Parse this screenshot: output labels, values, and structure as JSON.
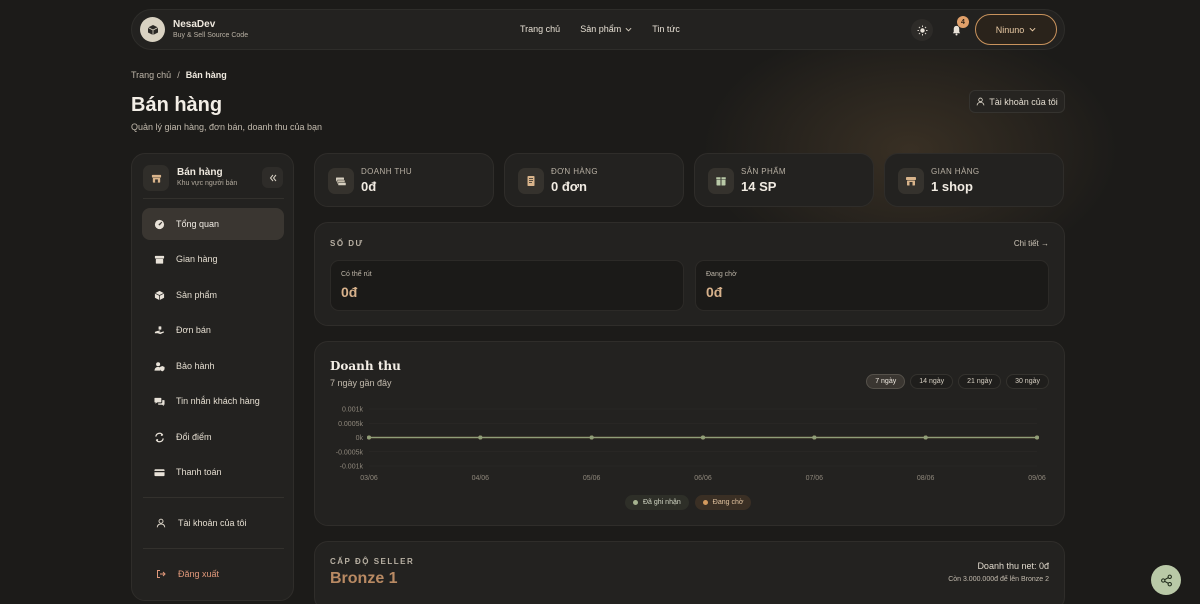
{
  "header": {
    "brand_name": "NesaDev",
    "brand_tagline": "Buy & Sell Source Code",
    "nav": [
      "Trang chủ",
      "Sản phẩm",
      "Tin tức"
    ],
    "notification_count": "4",
    "user_name": "Ninuno"
  },
  "breadcrumb": {
    "home": "Trang chủ",
    "separator": "/",
    "current": "Bán hàng"
  },
  "page": {
    "title": "Bán hàng",
    "subtitle": "Quản lý gian hàng, đơn bán, doanh thu của bạn",
    "account_button": "Tài khoản của tôi"
  },
  "sidebar": {
    "title": "Bán hàng",
    "subtitle": "Khu vực người bán",
    "items": [
      {
        "label": "Tổng quan",
        "icon": "dashboard-icon",
        "active": true
      },
      {
        "label": "Gian hàng",
        "icon": "store-icon"
      },
      {
        "label": "Sản phẩm",
        "icon": "box-icon"
      },
      {
        "label": "Đơn bán",
        "icon": "hand-icon"
      },
      {
        "label": "Bảo hành",
        "icon": "user-shield-icon"
      },
      {
        "label": "Tin nhắn khách hàng",
        "icon": "chat-icon"
      },
      {
        "label": "Đổi điểm",
        "icon": "exchange-icon"
      },
      {
        "label": "Thanh toán",
        "icon": "card-icon"
      }
    ],
    "account_item": "Tài khoản của tôi",
    "logout_item": "Đăng xuất"
  },
  "stats": [
    {
      "label": "DOANH THU",
      "value": "0đ",
      "icon": "money-icon"
    },
    {
      "label": "ĐƠN HÀNG",
      "value": "0 đơn",
      "icon": "receipt-icon"
    },
    {
      "label": "SẢN PHẨM",
      "value": "14 SP",
      "icon": "package-icon"
    },
    {
      "label": "GIAN HÀNG",
      "value": "1 shop",
      "icon": "shop-icon"
    }
  ],
  "balance": {
    "title": "SỐ DƯ",
    "detail_link": "Chi tiết →",
    "available_label": "Có thể rút",
    "available_value": "0đ",
    "pending_label": "Đang chờ",
    "pending_value": "0đ"
  },
  "revenue": {
    "title": "Doanh thu",
    "subtitle": "7 ngày gần đây",
    "ranges": [
      "7 ngày",
      "14 ngày",
      "21 ngày",
      "30 ngày"
    ],
    "active_range": 0
  },
  "chart_data": {
    "type": "line",
    "x": [
      "03/06",
      "04/06",
      "05/06",
      "06/06",
      "07/06",
      "08/06",
      "09/06"
    ],
    "y_ticks": [
      "0.001k",
      "0.0005k",
      "0k",
      "-0.0005k",
      "-0.001k"
    ],
    "ylim": [
      -0.001,
      0.001
    ],
    "series": [
      {
        "name": "Đã ghi nhận",
        "values": [
          0,
          0,
          0,
          0,
          0,
          0,
          0
        ],
        "color": "#8f9e78"
      },
      {
        "name": "Đang chờ",
        "values": [
          0,
          0,
          0,
          0,
          0,
          0,
          0
        ],
        "color": "#d49a5e"
      }
    ],
    "grid": true,
    "legend_position": "bottom-center"
  },
  "seller_level": {
    "title": "CẤP ĐỘ SELLER",
    "level": "Bronze 1",
    "net_revenue": "Doanh thu net: 0đ",
    "next_level": "Còn 3.000.000đ để lên Bronze 2"
  },
  "colors": {
    "accent": "#c9935d",
    "fab": "#b9c9a7",
    "line": "#8f9e78"
  }
}
